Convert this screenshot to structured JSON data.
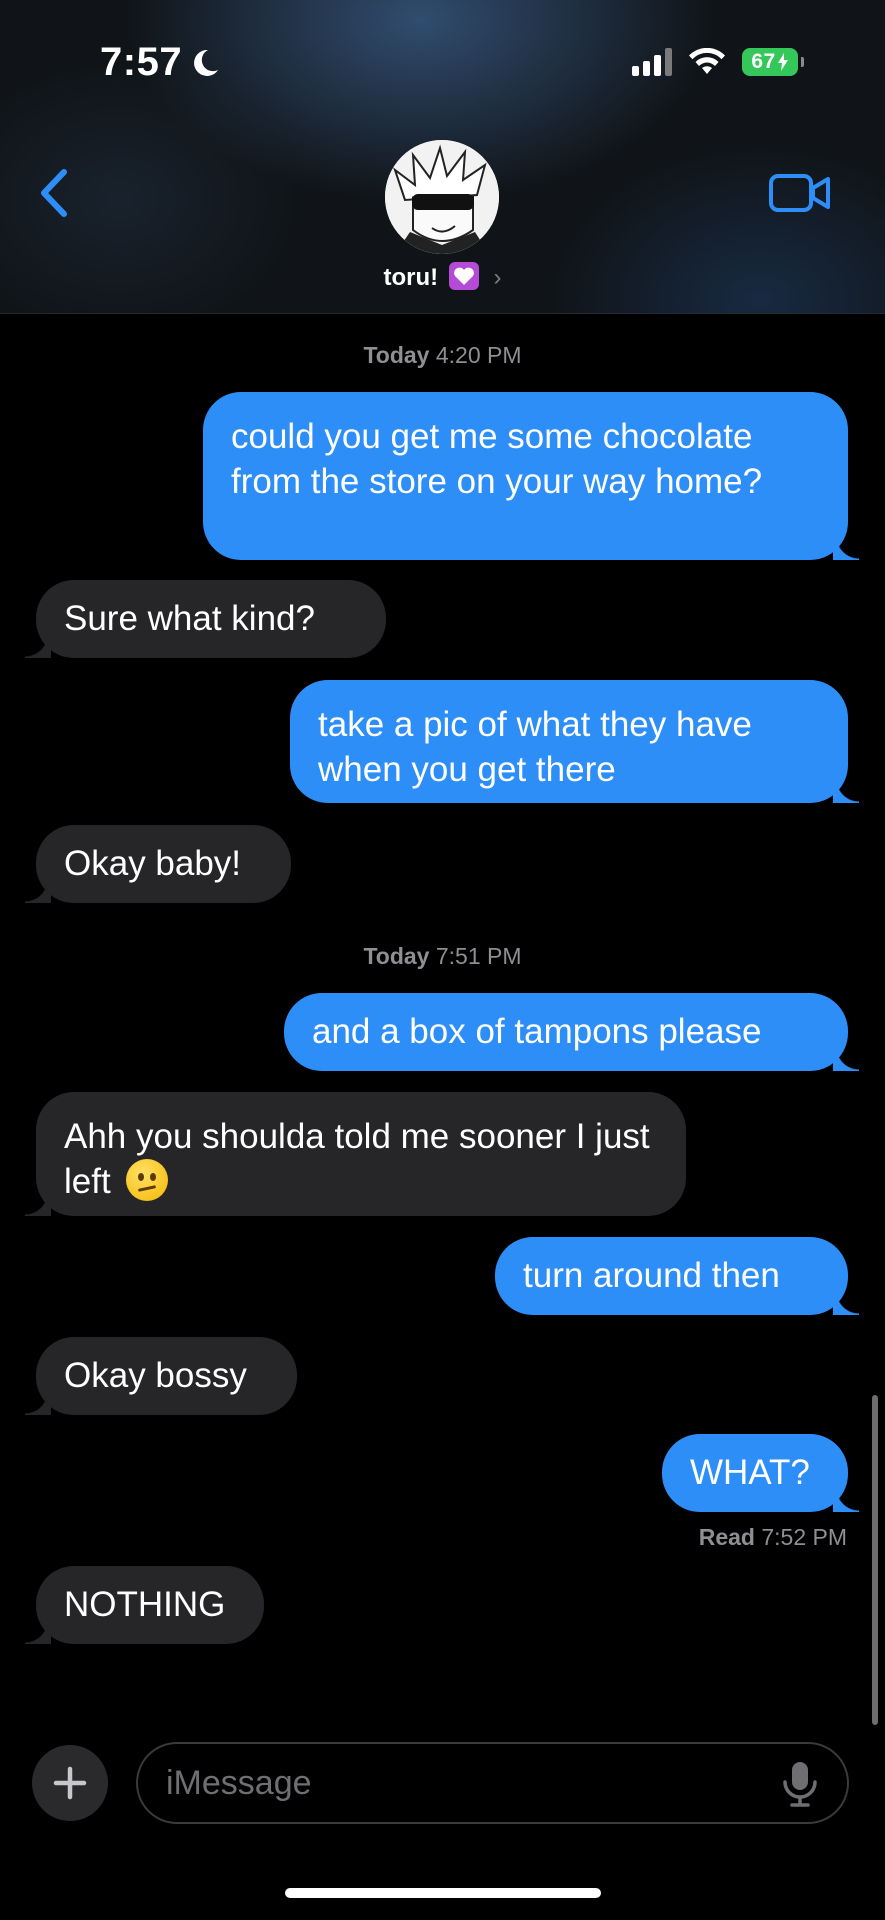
{
  "status_bar": {
    "time": "7:57",
    "battery": "67"
  },
  "header": {
    "contact_name": "toru!"
  },
  "messages": [
    {
      "type": "timestamp",
      "day": "Today",
      "time": "4:20 PM"
    },
    {
      "type": "sent",
      "text": "could you get me some chocolate from the store on your way home?"
    },
    {
      "type": "received",
      "text": "Sure what kind?"
    },
    {
      "type": "sent",
      "text": "take a pic of what they have when you get there"
    },
    {
      "type": "received",
      "text": "Okay baby!"
    },
    {
      "type": "timestamp",
      "day": "Today",
      "time": "7:51 PM"
    },
    {
      "type": "sent",
      "text": "and a box of tampons please"
    },
    {
      "type": "received",
      "text": "Ahh you shoulda told me sooner I just left",
      "emoji": "confused-face"
    },
    {
      "type": "sent",
      "text": "turn around then"
    },
    {
      "type": "received",
      "text": "Okay bossy"
    },
    {
      "type": "sent",
      "text": "WHAT?"
    },
    {
      "type": "received",
      "text": "NOTHING"
    }
  ],
  "read_receipt": {
    "label": "Read",
    "time": "7:52 PM"
  },
  "composer": {
    "placeholder": "iMessage"
  },
  "colors": {
    "sent_bubble": "#2e8ef8",
    "received_bubble": "#262628",
    "accent": "#2e8ef8",
    "battery": "#34c759"
  }
}
